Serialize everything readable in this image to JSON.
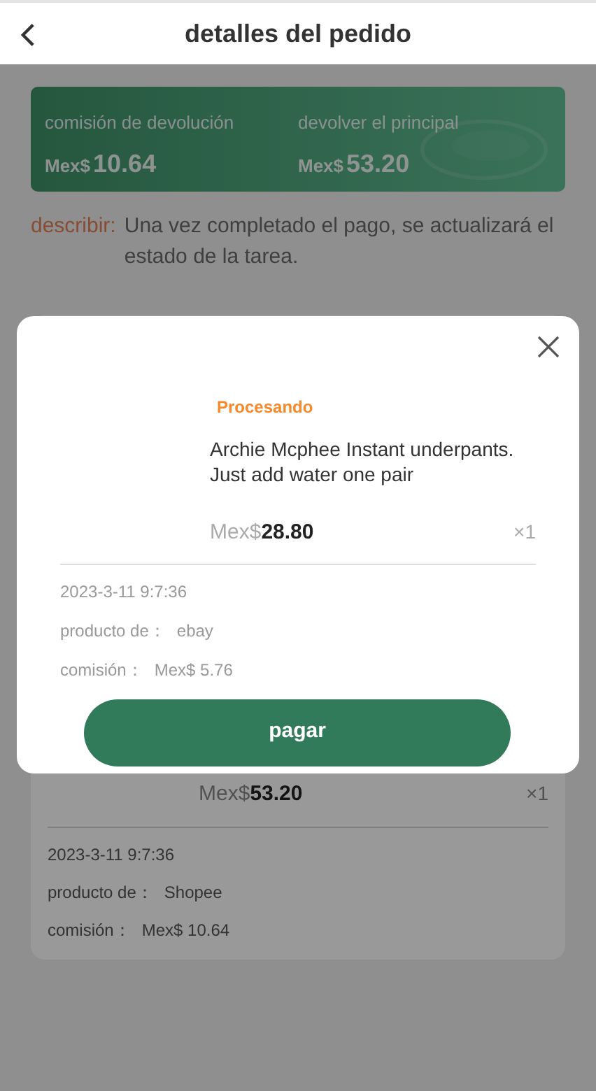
{
  "header": {
    "title": "detalles del pedido"
  },
  "summary": [
    {
      "label": "comisión de devolución",
      "currency": "Mex$",
      "amount": "10.64"
    },
    {
      "label": "devolver el principal",
      "currency": "Mex$",
      "amount": "53.20"
    }
  ],
  "description": {
    "label": "describir:",
    "text": "Una vez completado el pago, se actualizará el estado de la tarea."
  },
  "order_card": {
    "currency": "Mex$",
    "price": "53.20",
    "quantity": "×1",
    "date": "2023-3-11 9:7:36",
    "fields": [
      {
        "label": "producto de：",
        "value": "Shopee"
      },
      {
        "label": "comisión：",
        "value": "Mex$ 10.64"
      }
    ]
  },
  "modal": {
    "status": "Procesando",
    "product": "Archie Mcphee Instant underpants. Just add water one pair",
    "currency": "Mex$",
    "price": "28.80",
    "quantity": "×1",
    "date": "2023-3-11 9:7:36",
    "fields": [
      {
        "label": "producto de：",
        "value": "ebay"
      },
      {
        "label": "comisión：",
        "value": "Mex$ 5.76"
      }
    ],
    "button": "pagar"
  }
}
